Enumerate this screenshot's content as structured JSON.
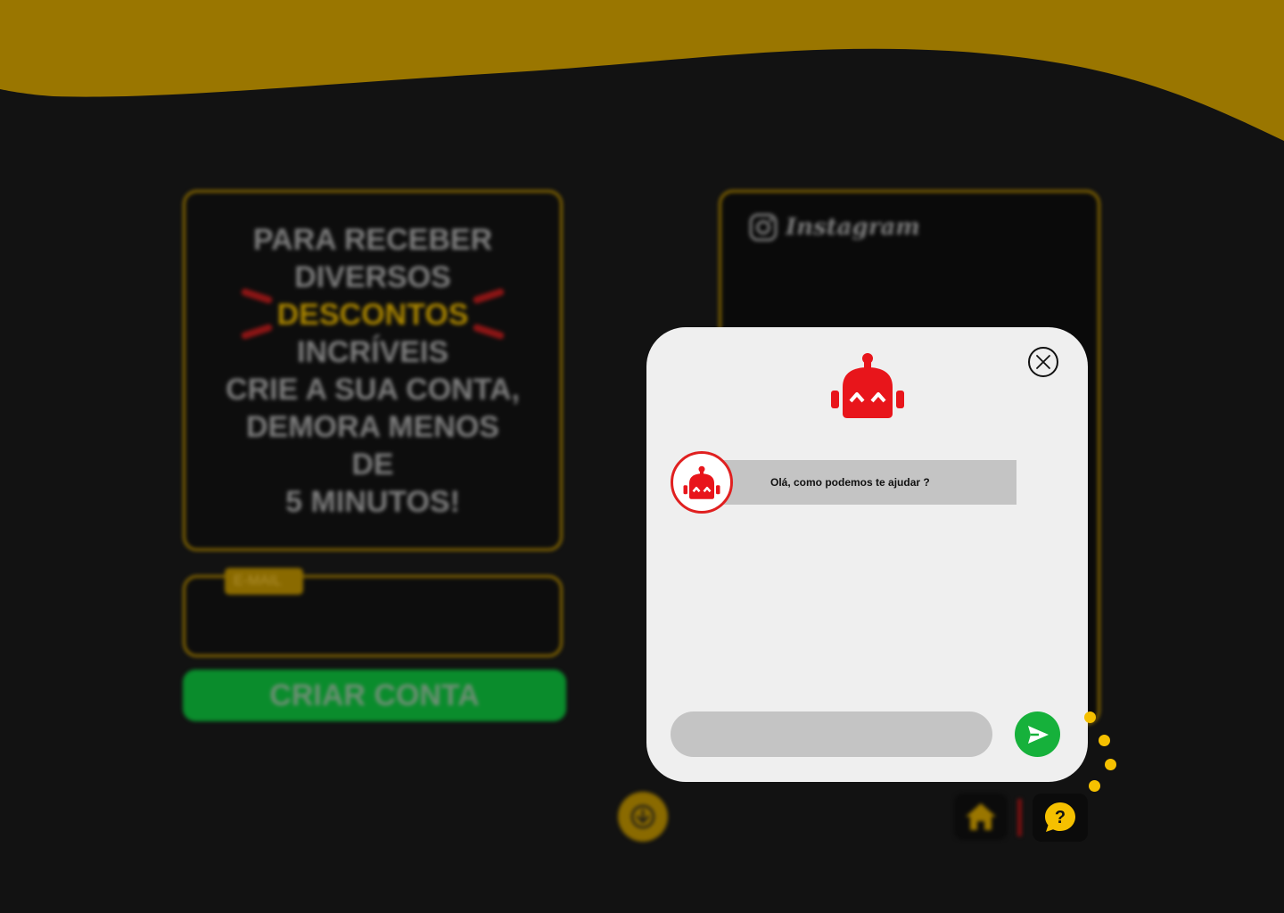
{
  "colors": {
    "accent_gold": "#9a7600",
    "background": "#121212",
    "brand_red": "#e8151b",
    "send_green": "#16b13b",
    "help_yellow": "#f5c000"
  },
  "promo": {
    "lines": [
      "PARA RECEBER",
      "DIVERSOS"
    ],
    "highlight": "DESCONTOS",
    "lines_after": [
      "INCRÍVEIS",
      "CRIE A SUA CONTA,",
      "DEMORA MENOS",
      "DE",
      "5 MINUTOS!"
    ]
  },
  "signup": {
    "email_label": "E-MAIL",
    "create_button": "CRIAR CONTA"
  },
  "instagram": {
    "icon": "instagram-icon",
    "name": "Instagram"
  },
  "chat": {
    "header_icon": "robot-icon",
    "close_icon": "close-icon",
    "messages": [
      {
        "sender": "bot",
        "text": "Olá, como podemos te ajudar ?"
      }
    ],
    "input_value": "",
    "send_icon": "send-icon"
  },
  "nav": {
    "scroll_icon": "arrow-down-icon",
    "home_icon": "home-icon",
    "help_icon": "help-bubble-icon"
  }
}
